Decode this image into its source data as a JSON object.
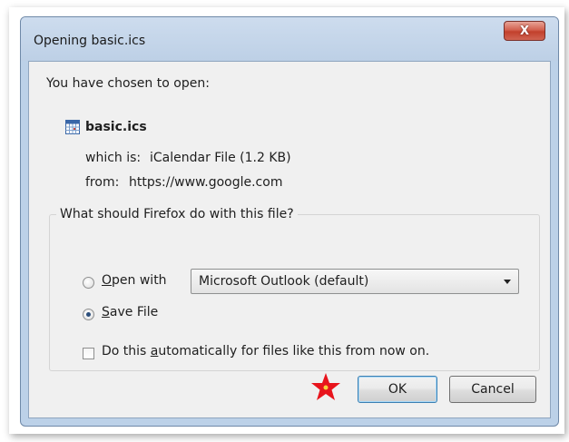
{
  "dialog": {
    "title": "Opening basic.ics",
    "close_label": "X"
  },
  "content": {
    "intro": "You have chosen to open:",
    "file_icon": "calendar-file-icon",
    "filename": "basic.ics",
    "which_is_label": "which is:",
    "which_is_value": "iCalendar File (1.2 KB)",
    "from_label": "from:",
    "from_value": "https://www.google.com"
  },
  "action_group": {
    "legend": "What should Firefox do with this file?",
    "open_with": {
      "label_accel": "O",
      "label_rest": "pen with",
      "selected": false
    },
    "open_with_app": "Microsoft Outlook (default)",
    "save_file": {
      "label_accel": "S",
      "label_rest": "ave File",
      "selected": true
    },
    "auto": {
      "label_before": "Do this ",
      "label_accel": "a",
      "label_after": "utomatically for files like this from now on.",
      "checked": false
    }
  },
  "buttons": {
    "ok": "OK",
    "cancel": "Cancel"
  },
  "marker": {
    "icon": "red-star-marker",
    "color": "#e8141c",
    "center_color": "#f7d23a"
  }
}
